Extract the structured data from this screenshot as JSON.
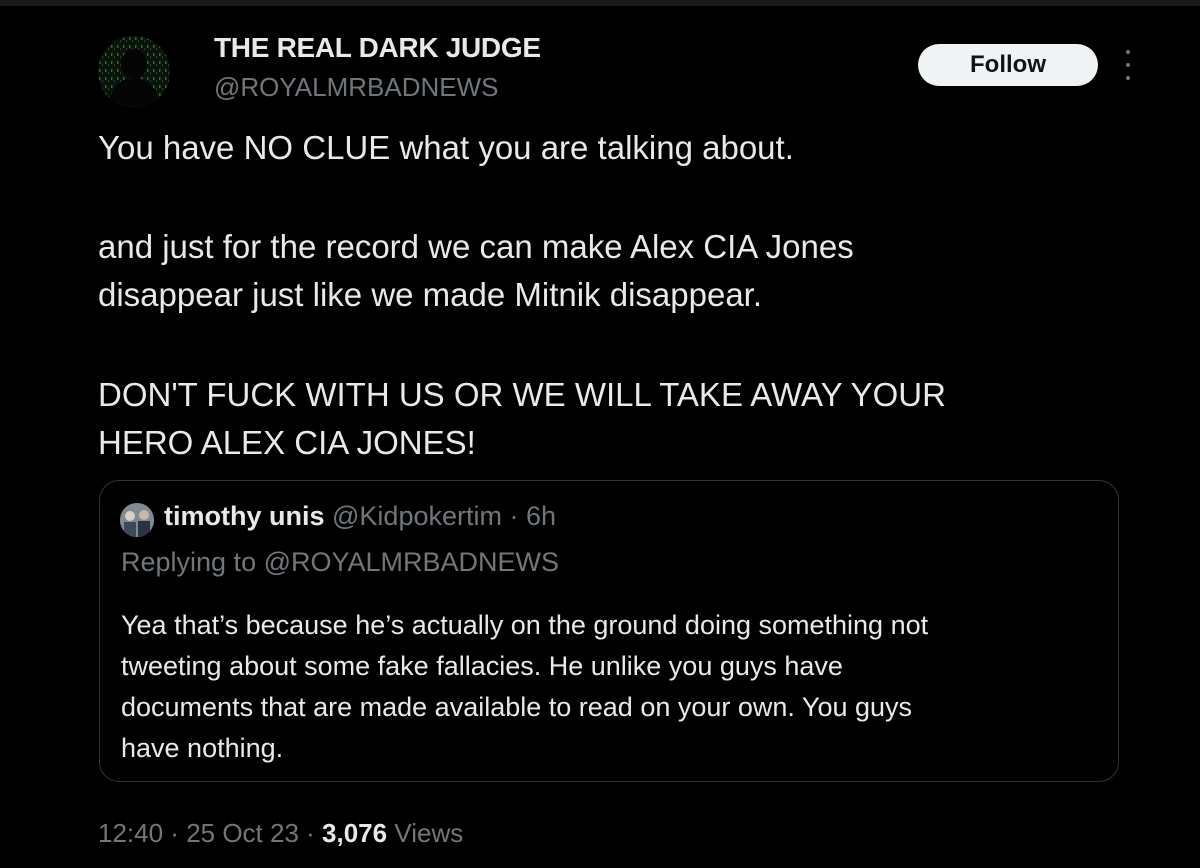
{
  "author": {
    "display_name": "THE REAL DARK JUDGE",
    "handle": "@ROYALMRBADNEWS",
    "avatar_icon": "hooded-figure-avatar"
  },
  "actions": {
    "follow_label": "Follow",
    "more_icon": "more-options-icon"
  },
  "tweet": {
    "lines": [
      "You have NO CLUE what you are talking about.",
      "and just for the record we can make Alex CIA Jones",
      "disappear just like we made Mitnik disappear.",
      "DON'T FUCK WITH US OR WE WILL TAKE AWAY YOUR",
      "HERO ALEX CIA JONES!"
    ]
  },
  "quoted": {
    "name": "timothy unis",
    "handle": "@Kidpokertim",
    "separator": " · ",
    "time": "6h",
    "replying_to": "Replying to @ROYALMRBADNEWS",
    "lines": [
      "Yea that’s because he’s actually on the ground doing something not",
      "tweeting about some fake fallacies. He unlike you guys have",
      "documents that are made available to read on your own. You guys",
      "have nothing."
    ]
  },
  "footer": {
    "time": "12:40",
    "separator": " · ",
    "date": "25 Oct 23",
    "views_count": "3,076",
    "views_label": " Views"
  },
  "colors": {
    "background": "#000000",
    "primary_text": "#e7e9ea",
    "secondary_text": "#71767b",
    "border": "#2f3336",
    "button_bg": "#eff3f4"
  }
}
